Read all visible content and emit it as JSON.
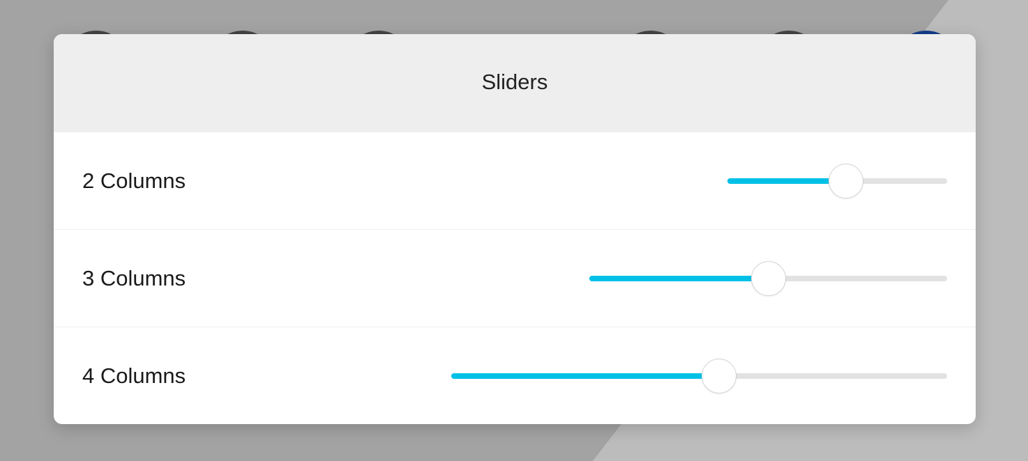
{
  "dialog": {
    "title": "Sliders"
  },
  "sliders": [
    {
      "label": "2 Columns",
      "value": 0.54
    },
    {
      "label": "3 Columns",
      "value": 0.5
    },
    {
      "label": "4 Columns",
      "value": 0.54
    }
  ],
  "colors": {
    "accent": "#00c0e6",
    "track": "#e2e2e2",
    "header_bg": "#eeeeee",
    "backdrop": "#a3a3a3"
  }
}
